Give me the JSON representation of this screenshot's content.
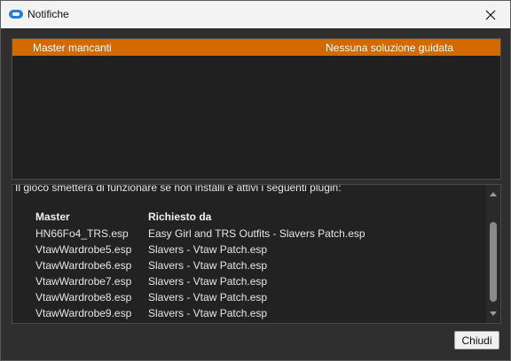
{
  "window": {
    "title": "Notifiche",
    "close_icon": "close-icon",
    "app_icon": "app-logo-icon"
  },
  "notifications": {
    "selected_color": "#d26a00",
    "rows": [
      {
        "type": "Master mancanti",
        "solution": "Nessuna soluzione guidata"
      }
    ]
  },
  "details": {
    "message": "Il gioco smetterà di funzionare se non installi e attivi i seguenti plugin:",
    "headers": {
      "master": "Master",
      "required_by": "Richiesto da"
    },
    "rows": [
      {
        "master": "HN66Fo4_TRS.esp",
        "required_by": "Easy Girl and TRS Outfits - Slavers Patch.esp"
      },
      {
        "master": "VtawWardrobe5.esp",
        "required_by": "Slavers - Vtaw Patch.esp"
      },
      {
        "master": "VtawWardrobe6.esp",
        "required_by": "Slavers - Vtaw Patch.esp"
      },
      {
        "master": "VtawWardrobe7.esp",
        "required_by": "Slavers - Vtaw Patch.esp"
      },
      {
        "master": "VtawWardrobe8.esp",
        "required_by": "Slavers - Vtaw Patch.esp"
      },
      {
        "master": "VtawWardrobe9.esp",
        "required_by": "Slavers - Vtaw Patch.esp"
      }
    ]
  },
  "footer": {
    "close_label": "Chiudi"
  }
}
